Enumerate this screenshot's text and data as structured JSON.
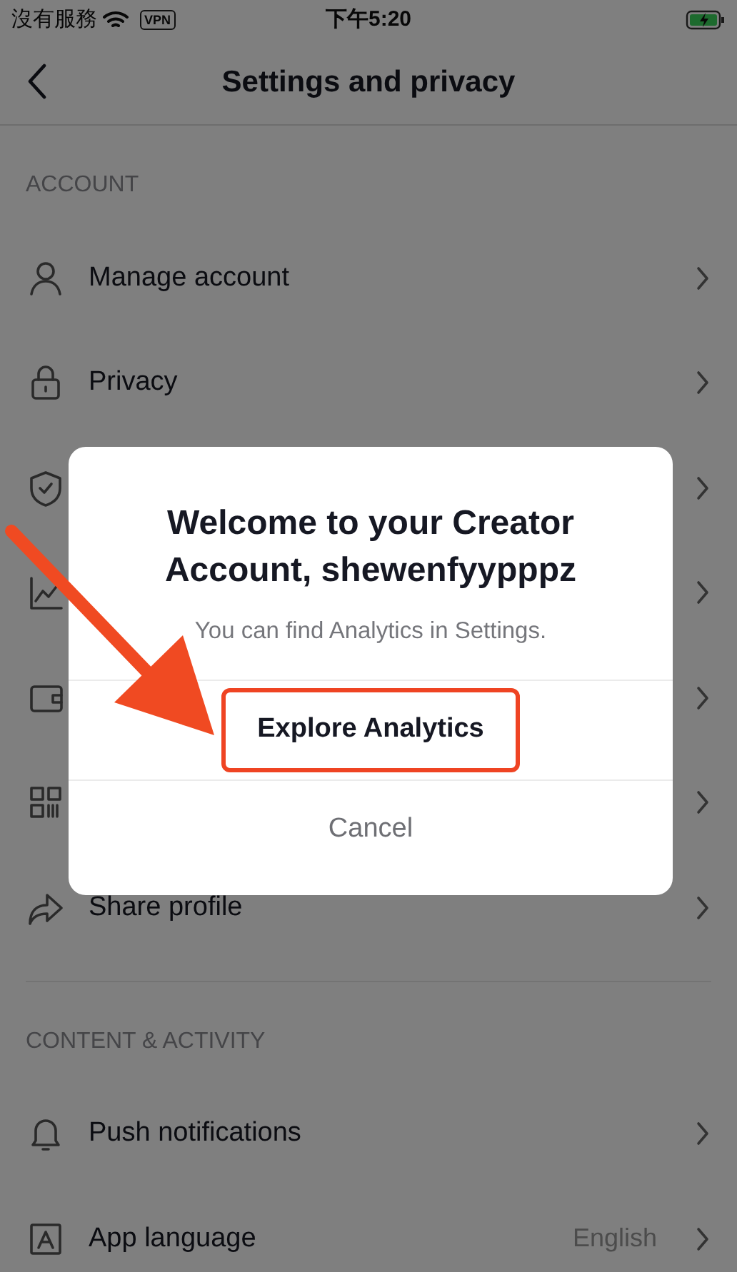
{
  "status_bar": {
    "carrier": "沒有服務",
    "vpn": "VPN",
    "time": "下午5:20"
  },
  "header": {
    "title": "Settings and privacy"
  },
  "sections": [
    {
      "heading": "ACCOUNT",
      "items": [
        {
          "kind": "labeled",
          "label": "Manage account"
        },
        {
          "kind": "labeled",
          "label": "Privacy"
        },
        {
          "kind": "covered"
        },
        {
          "kind": "covered"
        },
        {
          "kind": "covered"
        },
        {
          "kind": "covered"
        },
        {
          "kind": "labeled",
          "label": "Share profile"
        }
      ]
    },
    {
      "heading": "CONTENT & ACTIVITY",
      "items": [
        {
          "kind": "labeled",
          "label": "Push notifications"
        },
        {
          "kind": "labeled",
          "label": "App language",
          "value": "English"
        }
      ]
    }
  ],
  "dialog": {
    "title": "Welcome to your Creator Account, shewenfyypppz",
    "message": "You can find Analytics in Settings.",
    "buttons": [
      {
        "label": "Explore Analytics",
        "highlighted": true
      },
      {
        "label": "Cancel",
        "highlighted": false
      }
    ]
  }
}
